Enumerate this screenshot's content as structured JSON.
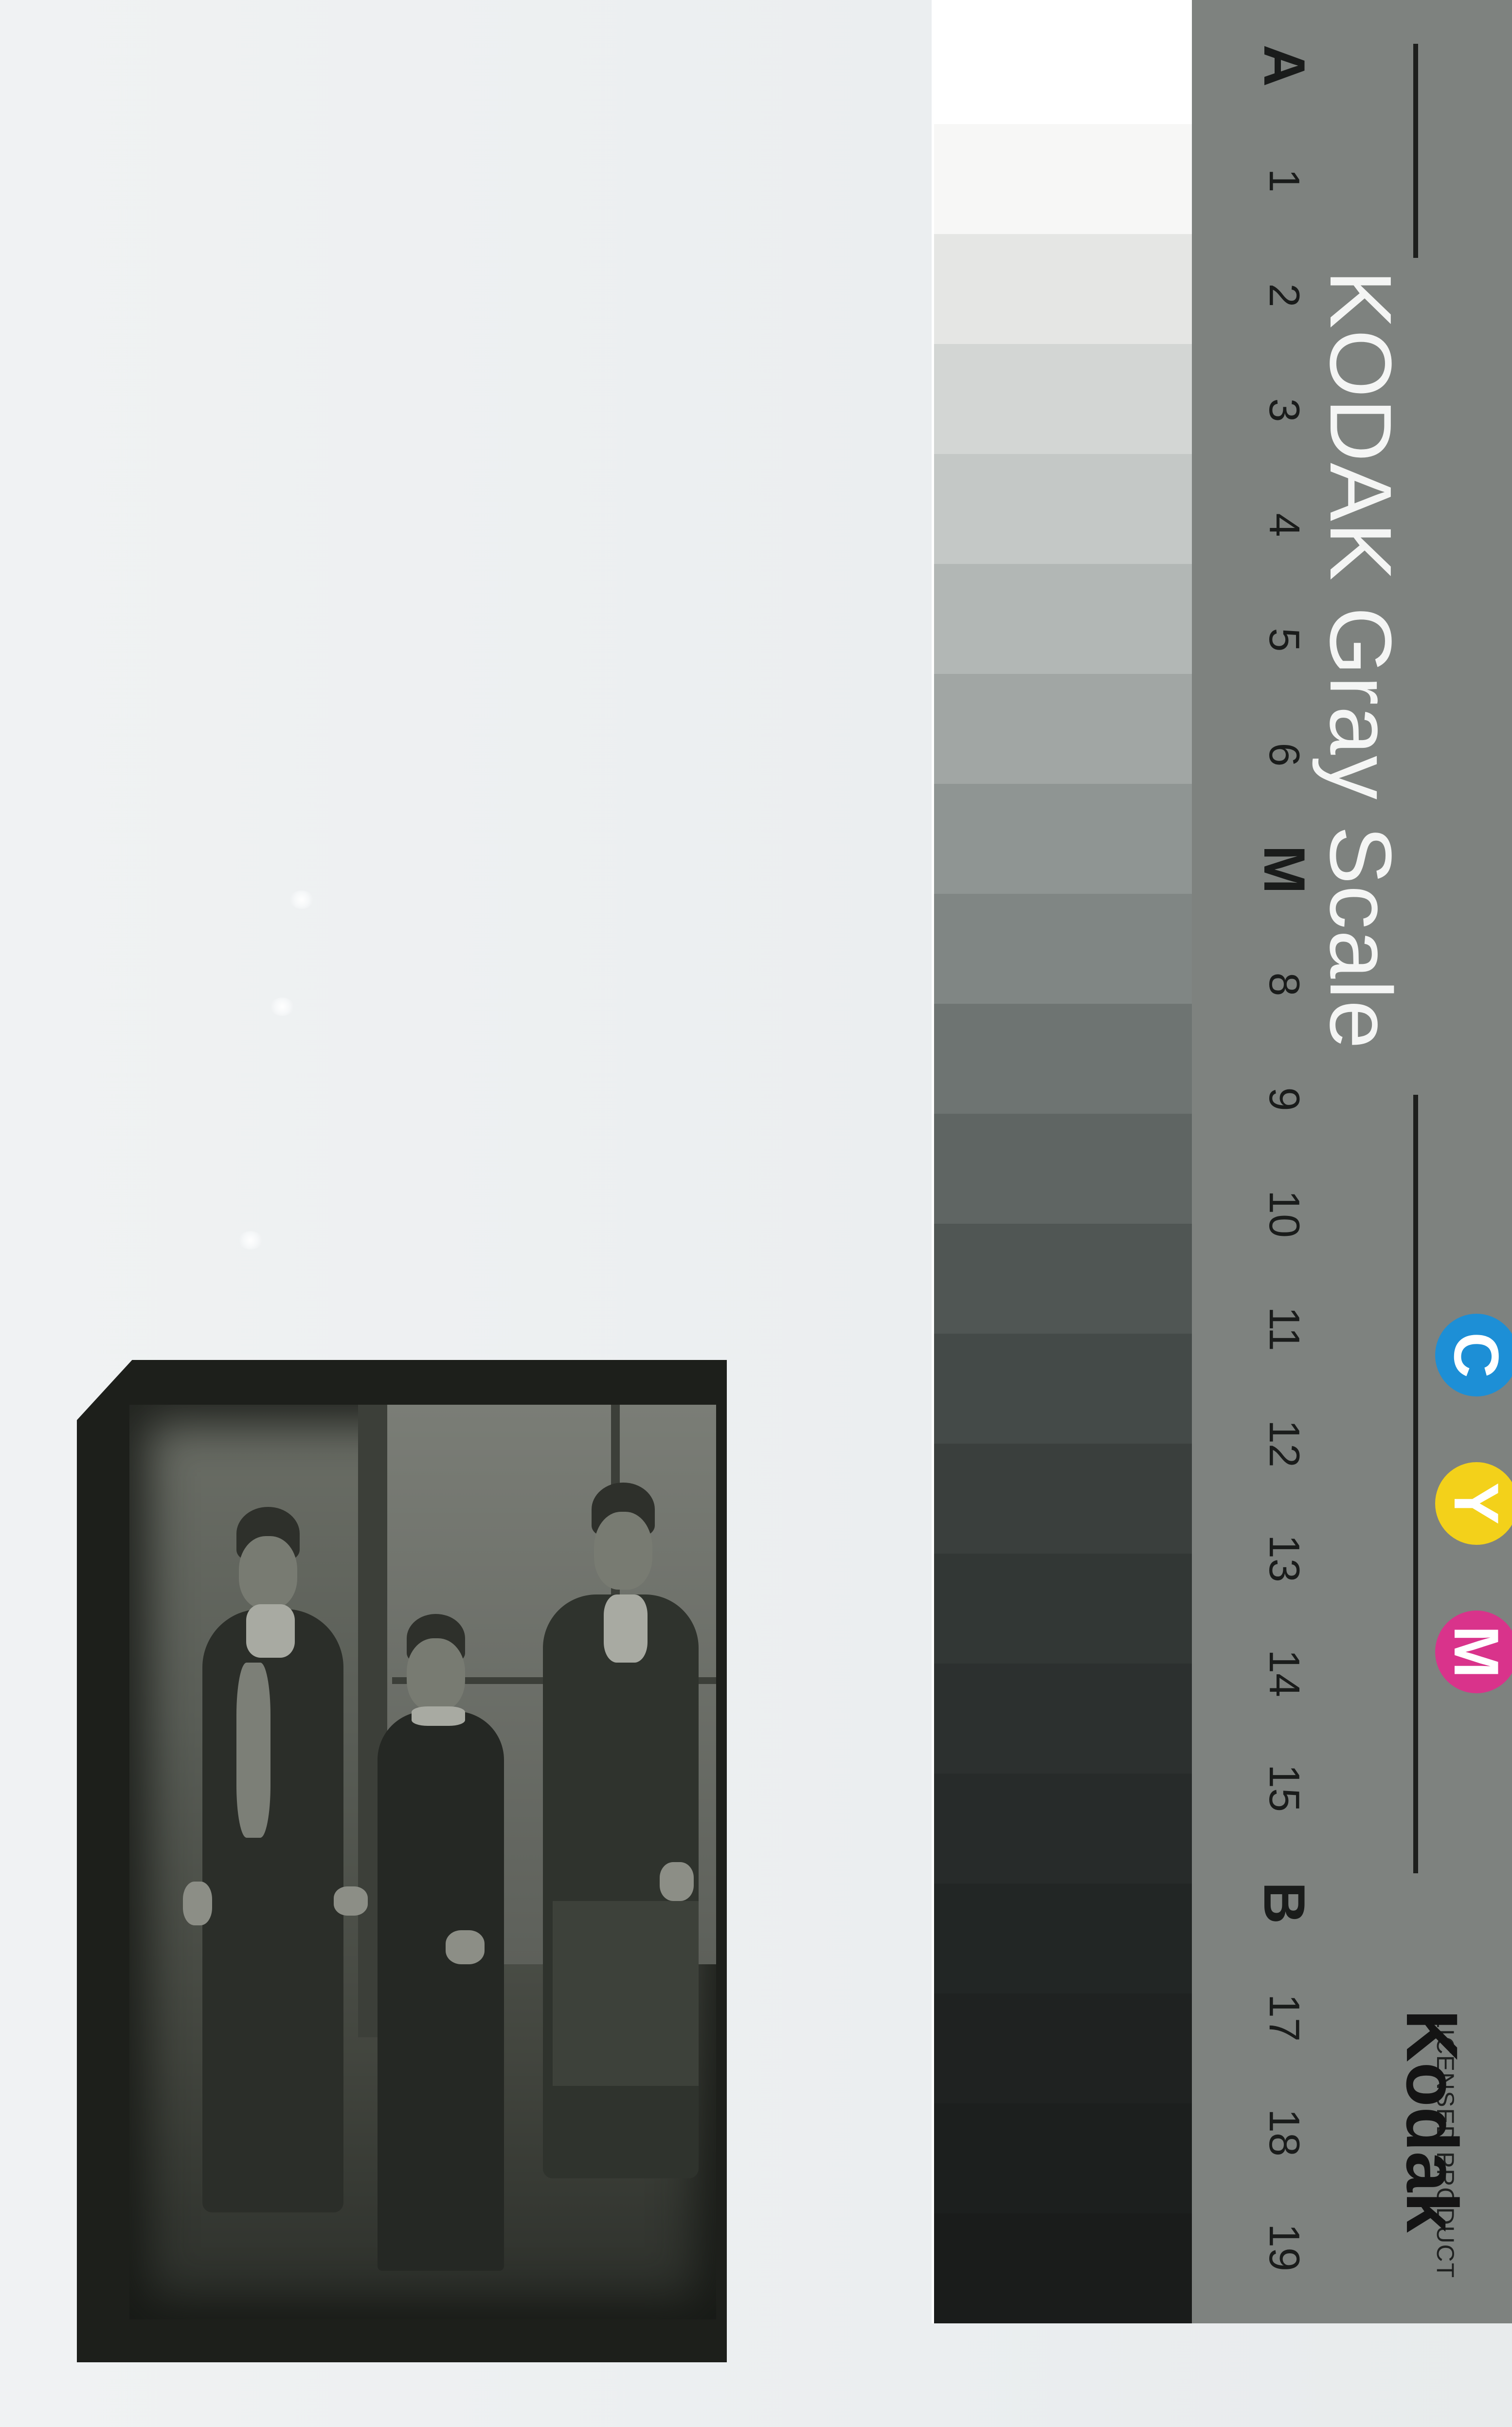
{
  "gray_scale": {
    "title": "KODAK Gray Scale",
    "markers": [
      "A",
      "1",
      "2",
      "3",
      "4",
      "5",
      "6",
      "M",
      "8",
      "9",
      "10",
      "11",
      "12",
      "13",
      "14",
      "15",
      "B",
      "17",
      "18",
      "19"
    ],
    "patch_colors": [
      "#f7f7f6",
      "#e5e6e4",
      "#d3d6d4",
      "#c4c8c6",
      "#b2b7b5",
      "#a1a6a4",
      "#8f9593",
      "#808684",
      "#6e7472",
      "#5f6563",
      "#505654",
      "#444a48",
      "#3a3f3d",
      "#323735",
      "#2c302f",
      "#272b2a",
      "#222625",
      "#1f2221",
      "#1c1f1e",
      "#1a1c1b"
    ],
    "color_dots": [
      {
        "letter": "C",
        "color": "#1d8fd6"
      },
      {
        "letter": "Y",
        "color": "#f3d11a"
      },
      {
        "letter": "M",
        "color": "#d9338b"
      }
    ],
    "brand": "Kodak",
    "licensed": "LICENSED PRODUCT"
  },
  "photo": {
    "subject": "tintype-portrait",
    "figure_count": 3
  }
}
